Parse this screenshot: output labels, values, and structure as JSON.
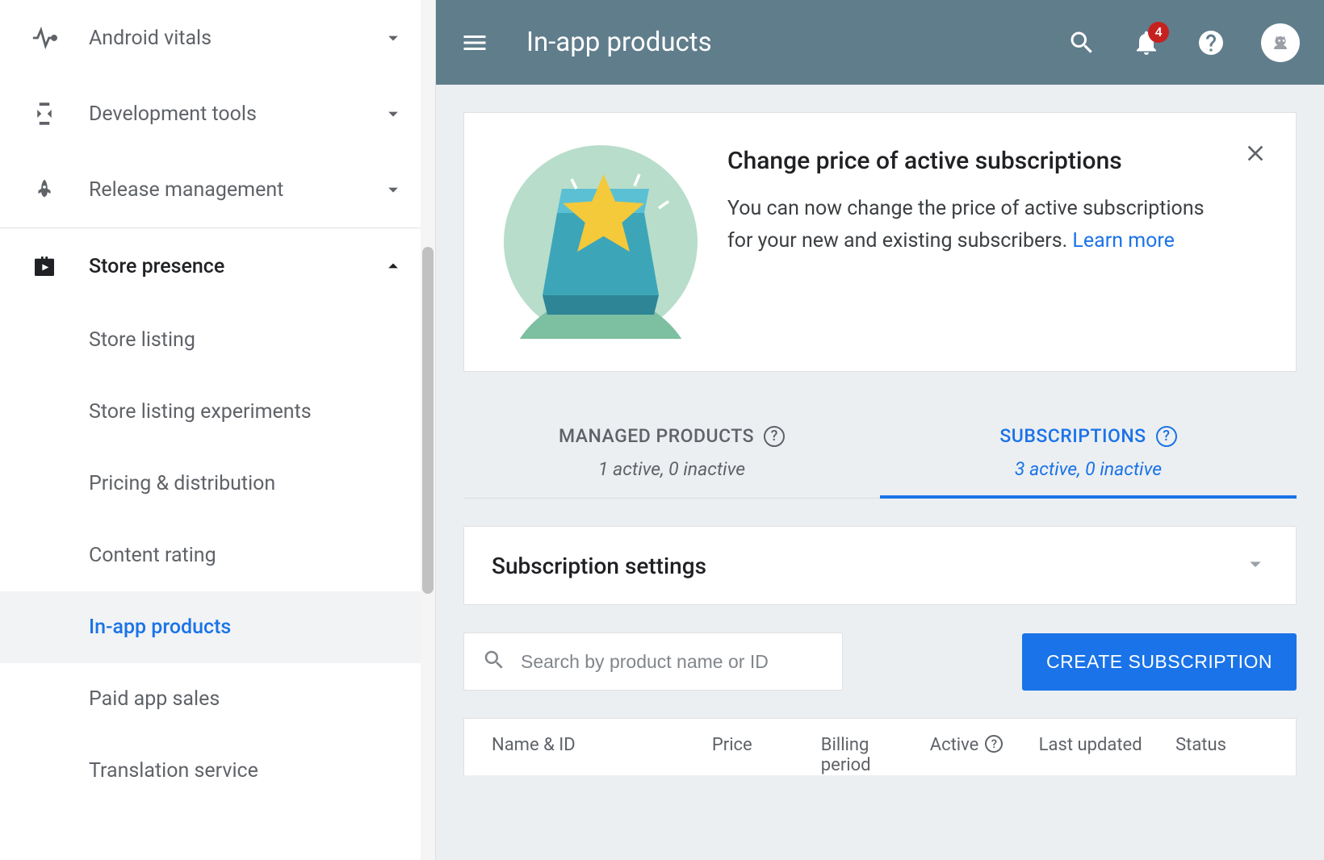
{
  "header": {
    "title": "In-app products",
    "notification_count": "4"
  },
  "sidebar": {
    "items": [
      {
        "label": "Android vitals",
        "icon": "vitals",
        "expanded": false
      },
      {
        "label": "Development tools",
        "icon": "devtools",
        "expanded": false
      },
      {
        "label": "Release management",
        "icon": "rocket",
        "expanded": false
      },
      {
        "label": "Store presence",
        "icon": "shop",
        "expanded": true
      }
    ],
    "store_presence_children": [
      {
        "label": "Store listing",
        "active": false
      },
      {
        "label": "Store listing experiments",
        "active": false
      },
      {
        "label": "Pricing & distribution",
        "active": false
      },
      {
        "label": "Content rating",
        "active": false
      },
      {
        "label": "In-app products",
        "active": true
      },
      {
        "label": "Paid app sales",
        "active": false
      },
      {
        "label": "Translation service",
        "active": false
      }
    ]
  },
  "banner": {
    "title": "Change price of active subscriptions",
    "desc": "You can now change the price of active subscriptions for your new and existing subscribers. ",
    "link_text": "Learn more"
  },
  "tabs": {
    "managed": {
      "label": "MANAGED PRODUCTS",
      "subtext": "1 active, 0 inactive"
    },
    "subscriptions": {
      "label": "SUBSCRIPTIONS",
      "subtext": "3 active, 0 inactive"
    }
  },
  "settings": {
    "title": "Subscription settings"
  },
  "search": {
    "placeholder": "Search by product name or ID"
  },
  "create_button": "CREATE SUBSCRIPTION",
  "table": {
    "cols": {
      "name": "Name & ID",
      "price": "Price",
      "billing": "Billing period",
      "active": "Active",
      "updated": "Last updated",
      "status": "Status"
    }
  }
}
